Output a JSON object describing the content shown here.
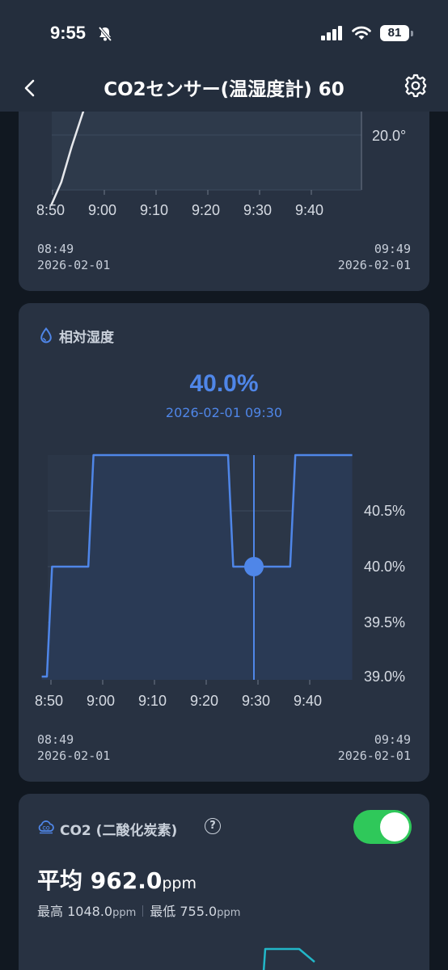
{
  "status": {
    "time": "9:55",
    "battery": "81"
  },
  "nav": {
    "title": "CO2センサー(温湿度計) 60"
  },
  "temp_card": {
    "y_tick": "20.0°",
    "x_ticks": [
      "8:50",
      "9:00",
      "9:10",
      "9:20",
      "9:30",
      "9:40"
    ],
    "range_start_time": "08:49",
    "range_start_date": "2026-02-01",
    "range_end_time": "09:49",
    "range_end_date": "2026-02-01"
  },
  "humidity_card": {
    "title": "相対湿度",
    "highlight_value": "40.0%",
    "highlight_datetime": "2026-02-01 09:30",
    "range_start_time": "08:49",
    "range_start_date": "2026-02-01",
    "range_end_time": "09:49",
    "range_end_date": "2026-02-01"
  },
  "co2_card": {
    "title": "CO2 (二酸化炭素)",
    "help_icon_label": "?",
    "toggle_on": true,
    "avg_label": "平均",
    "avg_value": "962.0",
    "unit": "ppm",
    "max_label": "最高",
    "max_value": "1048.0",
    "min_label": "最低",
    "min_value": "755.0"
  },
  "chart_data": [
    {
      "type": "line",
      "ylabel": "",
      "y_ticks": [
        "20.0°"
      ],
      "x_ticks": [
        "8:50",
        "9:00",
        "9:10",
        "9:20",
        "9:30",
        "9:40"
      ],
      "color": "#e6e8ec",
      "points": [
        {
          "x": "8:50",
          "y": 19.4
        },
        {
          "x": "8:52",
          "y": 19.6
        },
        {
          "x": "8:54",
          "y": 19.9
        },
        {
          "x": "8:57",
          "y": 20.3
        }
      ]
    },
    {
      "type": "area",
      "title": "相対湿度",
      "y_ticks": [
        "40.5%",
        "40.0%",
        "39.5%",
        "39.0%"
      ],
      "x_ticks": [
        "8:50",
        "9:00",
        "9:10",
        "9:20",
        "9:30",
        "9:40"
      ],
      "ylim": [
        38.9,
        41.0
      ],
      "color": "#4f86e8",
      "selected": {
        "x": "9:30",
        "y": 40.0
      },
      "points": [
        {
          "x": "8:49",
          "y": 39.0
        },
        {
          "x": "8:50",
          "y": 39.0
        },
        {
          "x": "8:51",
          "y": 40.0
        },
        {
          "x": "8:58",
          "y": 40.0
        },
        {
          "x": "8:59",
          "y": 41.0
        },
        {
          "x": "9:25",
          "y": 41.0
        },
        {
          "x": "9:26",
          "y": 40.0
        },
        {
          "x": "9:37",
          "y": 40.0
        },
        {
          "x": "9:38",
          "y": 41.0
        },
        {
          "x": "9:49",
          "y": 41.0
        }
      ]
    }
  ],
  "colors": {
    "accent": "#4f86e8",
    "toggle": "#2fc85a",
    "card": "#283242",
    "bg": "#111821"
  },
  "icons": [
    "bell-slash-icon",
    "signal-icon",
    "wifi-icon",
    "battery-icon",
    "chevron-left-icon",
    "gear-icon",
    "water-drop-icon",
    "co2-icon",
    "question-icon"
  ]
}
